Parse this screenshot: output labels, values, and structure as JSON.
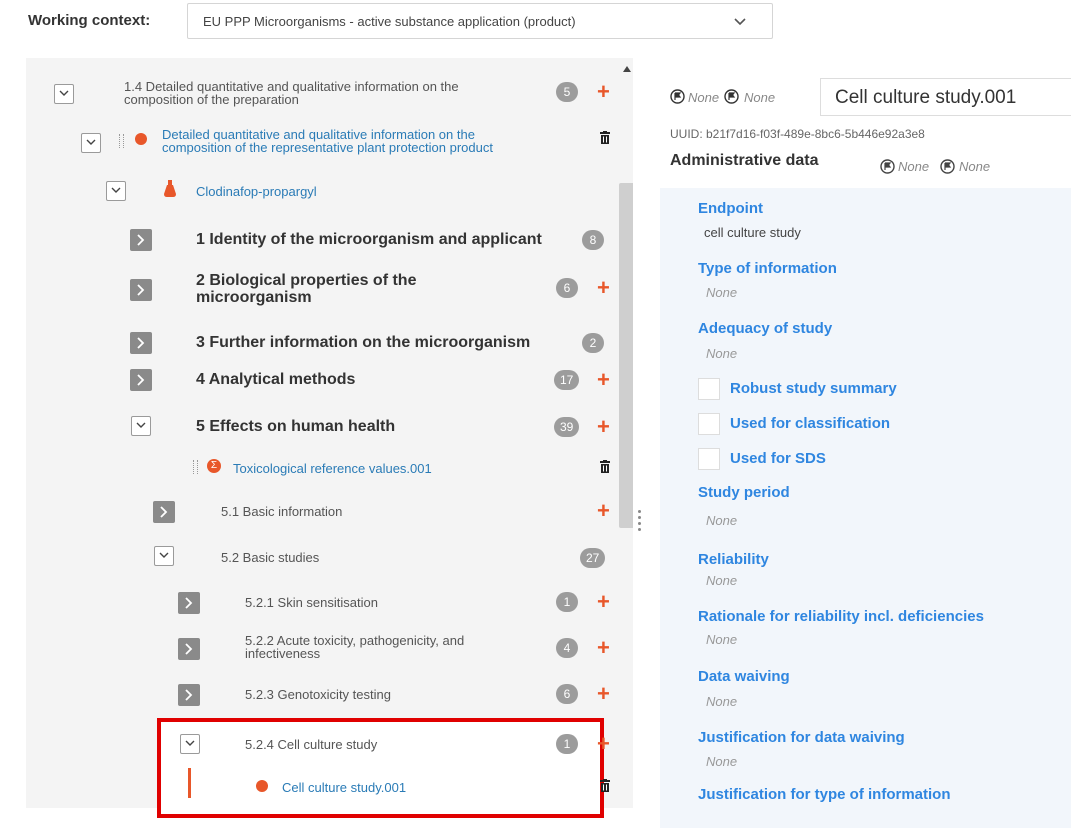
{
  "working_context": {
    "label": "Working context:",
    "value": "EU PPP Microorganisms - active substance application (product)"
  },
  "tree": {
    "n14": {
      "text_line1": "1.4 Detailed quantitative and qualitative information on the",
      "text_line2": "composition of the preparation",
      "badge": "5"
    },
    "detail": {
      "text_line1": "Detailed quantitative and qualitative information on the",
      "text_line2": "composition of the representative plant protection product"
    },
    "substance": {
      "text": "Clodinafop-propargyl"
    },
    "s1": {
      "text": "1 Identity of the microorganism and applicant",
      "badge": "8"
    },
    "s2": {
      "text_line1": "2 Biological properties of the",
      "text_line2": "microorganism",
      "badge": "6"
    },
    "s3": {
      "text": "3 Further information on the microorganism",
      "badge": "2"
    },
    "s4": {
      "text": "4 Analytical methods",
      "badge": "17"
    },
    "s5": {
      "text": "5 Effects on human health",
      "badge": "39"
    },
    "tox": {
      "text": "Toxicological reference values.001"
    },
    "s51": {
      "text": "5.1 Basic information"
    },
    "s52": {
      "text": "5.2 Basic studies",
      "badge": "27"
    },
    "s521": {
      "text": "5.2.1 Skin sensitisation",
      "badge": "1"
    },
    "s522": {
      "text_line1": "5.2.2 Acute toxicity, pathogenicity, and",
      "text_line2": "infectiveness",
      "badge": "4"
    },
    "s523": {
      "text": "5.2.3 Genotoxicity testing",
      "badge": "6"
    },
    "s524": {
      "text": "5.2.4 Cell culture study",
      "badge": "1"
    },
    "ccs": {
      "text": "Cell culture study.001"
    }
  },
  "detail": {
    "header_none_1": "None",
    "header_none_2": "None",
    "title": "Cell culture study.001",
    "uuid": "UUID: b21f7d16-f03f-489e-8bc6-5b446e92a3e8",
    "section": "Administrative data",
    "section_none_1": "None",
    "section_none_2": "None",
    "fields": {
      "endpoint_label": "Endpoint",
      "endpoint_value": "cell culture study",
      "type_label": "Type of information",
      "type_value": "None",
      "adequacy_label": "Adequacy of study",
      "adequacy_value": "None",
      "robust_label": "Robust study summary",
      "classification_label": "Used for classification",
      "sds_label": "Used for SDS",
      "period_label": "Study period",
      "period_value": "None",
      "reliability_label": "Reliability",
      "reliability_value": "None",
      "rationale_label": "Rationale for reliability incl. deficiencies",
      "rationale_value": "None",
      "waiving_label": "Data waiving",
      "waiving_value": "None",
      "just_waiving_label": "Justification for data waiving",
      "just_waiving_value": "None",
      "just_type_label": "Justification for type of information"
    }
  },
  "colors": {
    "accent_orange": "#e8572a",
    "link_blue": "#2f86e0",
    "highlight_red": "#e00000"
  }
}
